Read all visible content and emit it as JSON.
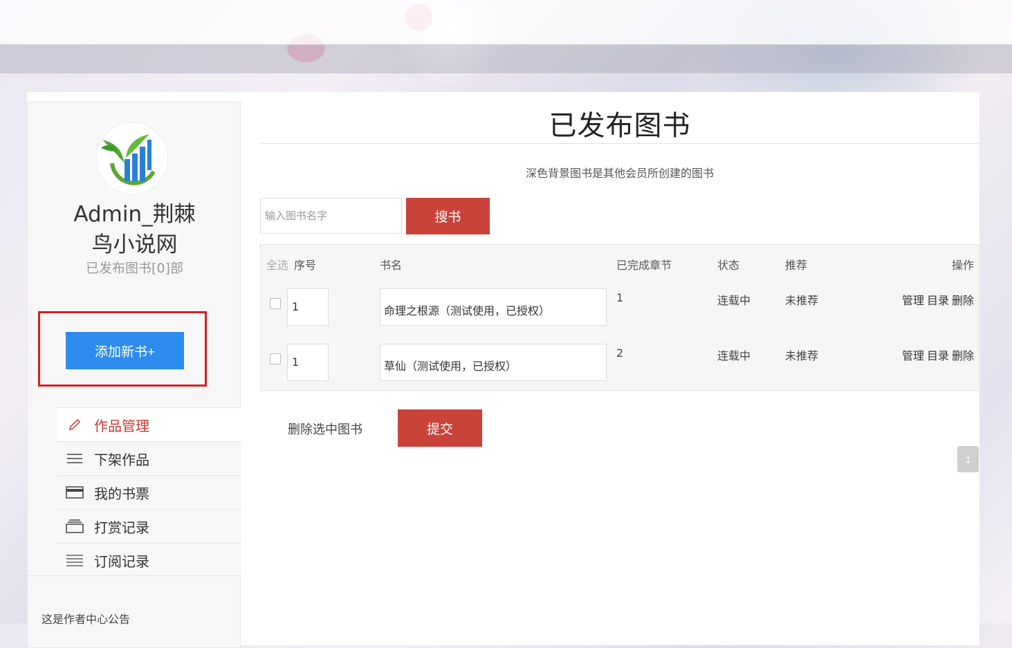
{
  "header": {},
  "sidebar": {
    "username": "Admin_荆棘鸟小说网",
    "published_count": "已发布图书[0]部",
    "add_book_label": "添加新书+",
    "menu": [
      {
        "label": "作品管理",
        "icon": "pencil-icon",
        "active": true
      },
      {
        "label": "下架作品",
        "icon": "menu-lines-icon",
        "active": false
      },
      {
        "label": "我的书票",
        "icon": "card-icon",
        "active": false
      },
      {
        "label": "打赏记录",
        "icon": "stack-icon",
        "active": false
      },
      {
        "label": "订阅记录",
        "icon": "list-icon",
        "active": false
      }
    ],
    "notice": "这是作者中心公告"
  },
  "main": {
    "title": "已发布图书",
    "hint": "深色背景图书是其他会员所创建的图书",
    "search": {
      "placeholder": "输入图书名字",
      "button_label": "搜书"
    },
    "table": {
      "headers": {
        "select_all": "全选",
        "index": "序号",
        "name": "书名",
        "chapters": "已完成章节",
        "status": "状态",
        "recommend": "推荐",
        "actions": "操作"
      },
      "rows": [
        {
          "index": "1",
          "name": "命理之根源（测试使用，已授权）",
          "chapters": "1",
          "status": "连载中",
          "recommend": "未推荐",
          "actions": [
            "管理",
            "目录",
            "删除"
          ]
        },
        {
          "index": "1",
          "name": "草仙（测试使用，已授权）",
          "chapters": "2",
          "status": "连载中",
          "recommend": "未推荐",
          "actions": [
            "管理",
            "目录",
            "删除"
          ]
        }
      ]
    },
    "delete_selected_label": "删除选中图书",
    "submit_label": "提交",
    "pagination": {
      "current": "1"
    }
  },
  "colors": {
    "accent_red": "#c9433a",
    "add_button_blue": "#2b8cee",
    "highlight_box": "#d81e1e",
    "active_menu_text": "#c9382f"
  }
}
